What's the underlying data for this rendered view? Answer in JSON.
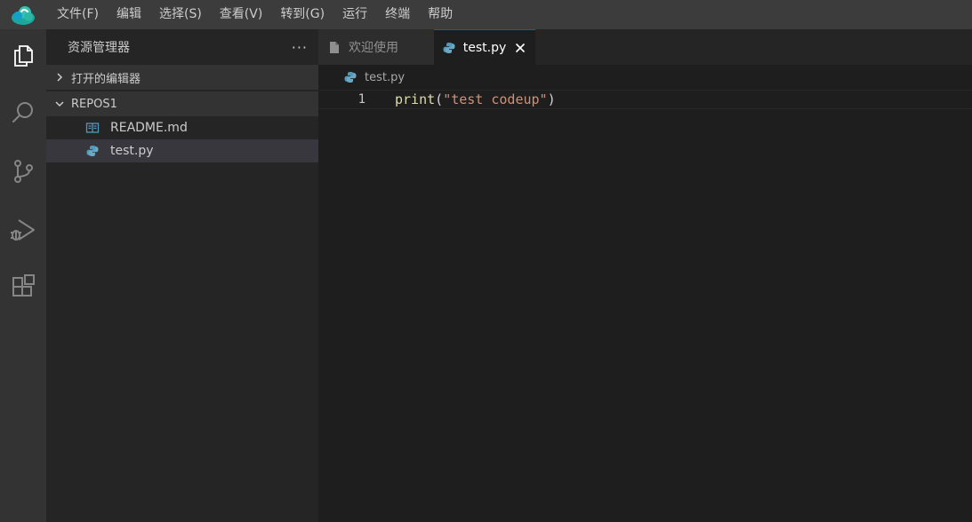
{
  "menu": {
    "items": [
      "文件(F)",
      "编辑",
      "选择(S)",
      "查看(V)",
      "转到(G)",
      "运行",
      "终端",
      "帮助"
    ]
  },
  "activity_bar": {
    "icons": [
      "files-icon",
      "search-icon",
      "source-control-icon",
      "run-debug-icon",
      "extensions-icon"
    ]
  },
  "sidebar": {
    "title": "资源管理器",
    "more": "···",
    "sections": {
      "open_editors": "打开的编辑器",
      "folder": "REPOS1"
    },
    "files": [
      {
        "name": "README.md",
        "icon": "markdown-file-icon"
      },
      {
        "name": "test.py",
        "icon": "python-file-icon"
      }
    ]
  },
  "editor": {
    "tabs": [
      {
        "label": "欢迎使用",
        "icon": "file-icon",
        "active": false
      },
      {
        "label": "test.py",
        "icon": "python-file-icon",
        "active": true
      }
    ],
    "breadcrumb": "test.py",
    "line_number": "1",
    "code": {
      "fn": "print",
      "open": "(",
      "string": "\"test codeup\"",
      "close": ")"
    }
  },
  "colors": {
    "accent": "#0e639c",
    "python_blue": "#519aba",
    "string": "#ce9178",
    "function": "#dcdcaa"
  }
}
